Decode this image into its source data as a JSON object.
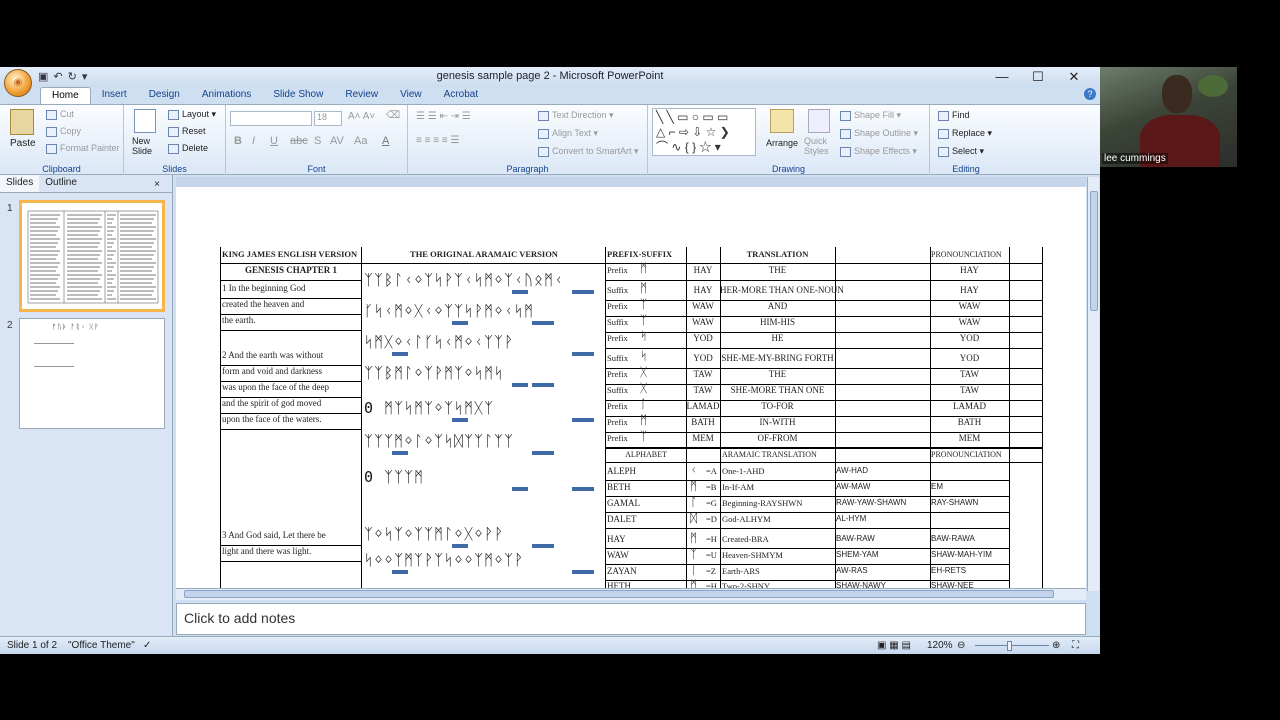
{
  "window": {
    "title": "genesis sample page 2 - Microsoft PowerPoint"
  },
  "tabs": [
    "Home",
    "Insert",
    "Design",
    "Animations",
    "Slide Show",
    "Review",
    "View",
    "Acrobat"
  ],
  "ribbon": {
    "clipboard": {
      "label": "Clipboard",
      "paste": "Paste",
      "cut": "Cut",
      "copy": "Copy",
      "format_painter": "Format Painter"
    },
    "slides": {
      "label": "Slides",
      "new_slide": "New Slide",
      "layout": "Layout",
      "reset": "Reset",
      "delete": "Delete"
    },
    "font": {
      "label": "Font",
      "size": "18"
    },
    "paragraph": {
      "label": "Paragraph",
      "text_direction": "Text Direction",
      "align_text": "Align Text",
      "convert_smartart": "Convert to SmartArt"
    },
    "drawing": {
      "label": "Drawing",
      "arrange": "Arrange",
      "quick_styles": "Quick Styles",
      "shape_fill": "Shape Fill",
      "shape_outline": "Shape Outline",
      "shape_effects": "Shape Effects"
    },
    "editing": {
      "label": "Editing",
      "find": "Find",
      "replace": "Replace",
      "select": "Select"
    }
  },
  "panel": {
    "tab_slides": "Slides",
    "tab_outline": "Outline",
    "slide_numbers": [
      "1",
      "2"
    ],
    "thumb2_text": "ᚠᚢᚦ ᚨᚱᚲ ᚷᚹ"
  },
  "slide_table": {
    "headers": {
      "kjv": "KING JAMES ENGLISH VERSION",
      "aramaic": "THE ORIGINAL ARAMAIC VERSION",
      "prefix_suffix": "PREFIX-SUFFIX",
      "translation": "TRANSLATION",
      "pronunciation": "PRONOUNCIATION"
    },
    "kjv_lines": [
      "GENESIS CHAPTER 1",
      "1 In the beginning God",
      "created the heaven and",
      "the earth.",
      "2 And the earth was without",
      "form and void and darkness",
      "was upon the face of the deep",
      "and the spirit of god moved",
      "upon the face of the waters.",
      "3 And God said, Let there be",
      "light and there was light."
    ],
    "aramaic_lines": [
      "ᛉᛉᛒᛚᚲᛜᛉᛋᚹᛉᚲᛋᛗᛜᛉᚲᚢᛟᛗᚲ",
      "ᚴᛋᚲᛗᛜᚷᚲᛜᛉᛉᛋᚹᛗᛜᚲᛋᛗ",
      "ᛋᛗᚷᛜᚲᛚᚴᛋᚲᛗᛜᚲᛉᛉᚹ",
      "ᛉᛉᛒᛗᛚᛜᛉᚹᛗᛉᛜᛋᛗᛋ",
      "0  ᛗᛉᛋᛗᛉᛜᛉᛋᛗᚷᛉ",
      "ᛉᛉᛉᛗᛜᛚᛜᛉᛋᛞᛉᛉᛚᛉᛉ",
      "0                ᛉᛉᛉᛗ",
      "ᛉᛜᛋᛉᛜᛉᛉᛗᛚᛜᚷᛜᚹᚹ",
      "ᛋᛜᛜᛉᛗᛉᚹᛉᛋᛜᛜᛉᛗᛜᛉᚹ"
    ],
    "prefix_rows": [
      {
        "ps": "Prefix",
        "letter": "ᛗ",
        "name": "HAY",
        "trans": "THE",
        "pron": "HAY"
      },
      {
        "ps": "Suffix",
        "letter": "ᛗ",
        "name": "HAY",
        "trans": "HER-MORE THAN ONE-NOUN",
        "pron": "HAY"
      },
      {
        "ps": "Prefix",
        "letter": "ᛉ",
        "name": "WAW",
        "trans": "AND",
        "pron": "WAW"
      },
      {
        "ps": "Suffix",
        "letter": "ᛉ",
        "name": "WAW",
        "trans": "HIM-HIS",
        "pron": "WAW"
      },
      {
        "ps": "Prefix",
        "letter": "ᛋ",
        "name": "YOD",
        "trans": "HE",
        "pron": "YOD"
      },
      {
        "ps": "Suffix",
        "letter": "ᛋ",
        "name": "YOD",
        "trans": "SHE-ME-MY-BRING FORTH",
        "pron": "YOD"
      },
      {
        "ps": "Prefix",
        "letter": "ᚷ",
        "name": "TAW",
        "trans": "THE",
        "pron": "TAW"
      },
      {
        "ps": "Suffix",
        "letter": "ᚷ",
        "name": "TAW",
        "trans": "SHE-MORE THAN ONE",
        "pron": "TAW"
      },
      {
        "ps": "Prefix",
        "letter": "ᛚ",
        "name": "LAMAD",
        "trans": "TO-FOR",
        "pron": "LAMAD"
      },
      {
        "ps": "Prefix",
        "letter": "ᛗ",
        "name": "BATH",
        "trans": "IN-WITH",
        "pron": "BATH"
      },
      {
        "ps": "Prefix",
        "letter": "ᛉ",
        "name": "MEM",
        "trans": "OF-FROM",
        "pron": "MEM"
      }
    ],
    "alphabet_headers": {
      "alphabet": "ALPHABET",
      "aramaic_translation": "ARAMAIC TRANSLATION",
      "pronunciation": "PRONOUNCIATION"
    },
    "alphabet_rows": [
      {
        "name": "ALEPH",
        "glyph": "ᚲ",
        "eq": "=A",
        "trans": "One-1-AHD",
        "pron1": "AW-HAD",
        "pron2": ""
      },
      {
        "name": "BETH",
        "glyph": "ᛗ",
        "eq": "=B",
        "trans": "In-If-AM",
        "pron1": "AW-MAW",
        "pron2": "EM"
      },
      {
        "name": "GAMAL",
        "glyph": "ᛚ",
        "eq": "=G",
        "trans": "Beginning-RAYSHWN",
        "pron1": "RAW-YAW-SHAWN",
        "pron2": "RAY-SHAWN"
      },
      {
        "name": "DALET",
        "glyph": "ᛞ",
        "eq": "=D",
        "trans": "God-ALHYM",
        "pron1": "AL-HYM",
        "pron2": ""
      },
      {
        "name": "HAY",
        "glyph": "ᛗ",
        "eq": "=H",
        "trans": "Created-BRA",
        "pron1": "BAW-RAW",
        "pron2": "BAW-RAWA"
      },
      {
        "name": "WAW",
        "glyph": "ᛉ",
        "eq": "=U",
        "trans": "Heaven-SHMYM",
        "pron1": "SHEM-YAM",
        "pron2": "SHAW-MAH-YIM"
      },
      {
        "name": "ZAYAN",
        "glyph": "ᛁ",
        "eq": "=Z",
        "trans": "Earth-ARS",
        "pron1": "AW-RAS",
        "pron2": "EH-RETS"
      },
      {
        "name": "HETH",
        "glyph": "ᛗ",
        "eq": "=H",
        "trans": "Two-2-SHNY",
        "pron1": "SHAW-NAWY",
        "pron2": "SHAW-NEE"
      }
    ]
  },
  "notes": {
    "placeholder": "Click to add notes"
  },
  "status": {
    "slide": "Slide 1 of 2",
    "theme": "\"Office Theme\"",
    "zoom": "120%"
  },
  "webcam": {
    "name": "lee cummings"
  },
  "colors": {
    "ribbon_text": "#15428b",
    "selected_thumb": "#f5b44c",
    "underline": "#3f6aa8"
  }
}
